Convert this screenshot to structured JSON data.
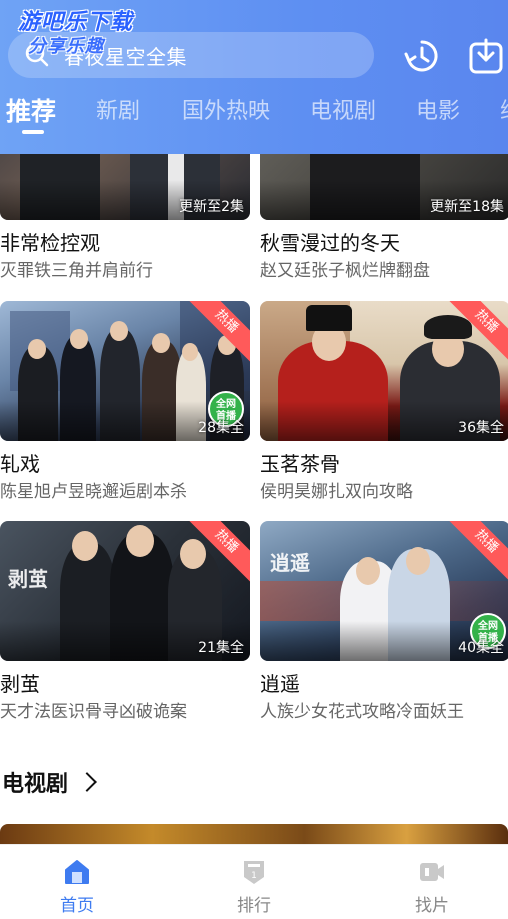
{
  "watermark": {
    "main": "游吧乐下载",
    "sub": "分享乐趣"
  },
  "search": {
    "placeholder": "春夜星空全集"
  },
  "tabs": [
    "推荐",
    "新剧",
    "国外热映",
    "电视剧",
    "电影",
    "综"
  ],
  "cards": [
    {
      "title": "非常检控观",
      "subtitle": "灭罪铁三角并肩前行",
      "episodes": "更新至2集",
      "hot": false,
      "full_badge": false
    },
    {
      "title": "秋雪漫过的冬天",
      "subtitle": "赵又廷张子枫烂牌翻盘",
      "episodes": "更新至18集",
      "hot": false,
      "full_badge": false
    },
    {
      "title": "轧戏",
      "subtitle": "陈星旭卢昱晓邂逅剧本杀",
      "episodes": "28集全",
      "hot": true,
      "full_badge": true
    },
    {
      "title": "玉茗茶骨",
      "subtitle": "侯明昊娜扎双向攻略",
      "episodes": "36集全",
      "hot": true,
      "full_badge": false
    },
    {
      "title": "剥茧",
      "subtitle": "天才法医识骨寻凶破诡案",
      "episodes": "21集全",
      "hot": true,
      "full_badge": false
    },
    {
      "title": "逍遥",
      "subtitle": "人族少女花式攻略冷面妖王",
      "episodes": "40集全",
      "hot": true,
      "full_badge": true
    }
  ],
  "badges": {
    "hot": "热播",
    "full_top": "全网",
    "full_bottom": "首播"
  },
  "poster_titles": {
    "boxian": "剥茧",
    "xiaoyao": "逍遥"
  },
  "section": {
    "title": "电视剧"
  },
  "bottom_nav": [
    {
      "label": "首页",
      "icon": "home-icon",
      "active": true
    },
    {
      "label": "排行",
      "icon": "ranking-icon",
      "active": false
    },
    {
      "label": "找片",
      "icon": "find-video-icon",
      "active": false
    }
  ],
  "colors": {
    "header": "#5e8ff2",
    "accent": "#3e7bf0",
    "hot_badge": "#ff5a5a"
  }
}
